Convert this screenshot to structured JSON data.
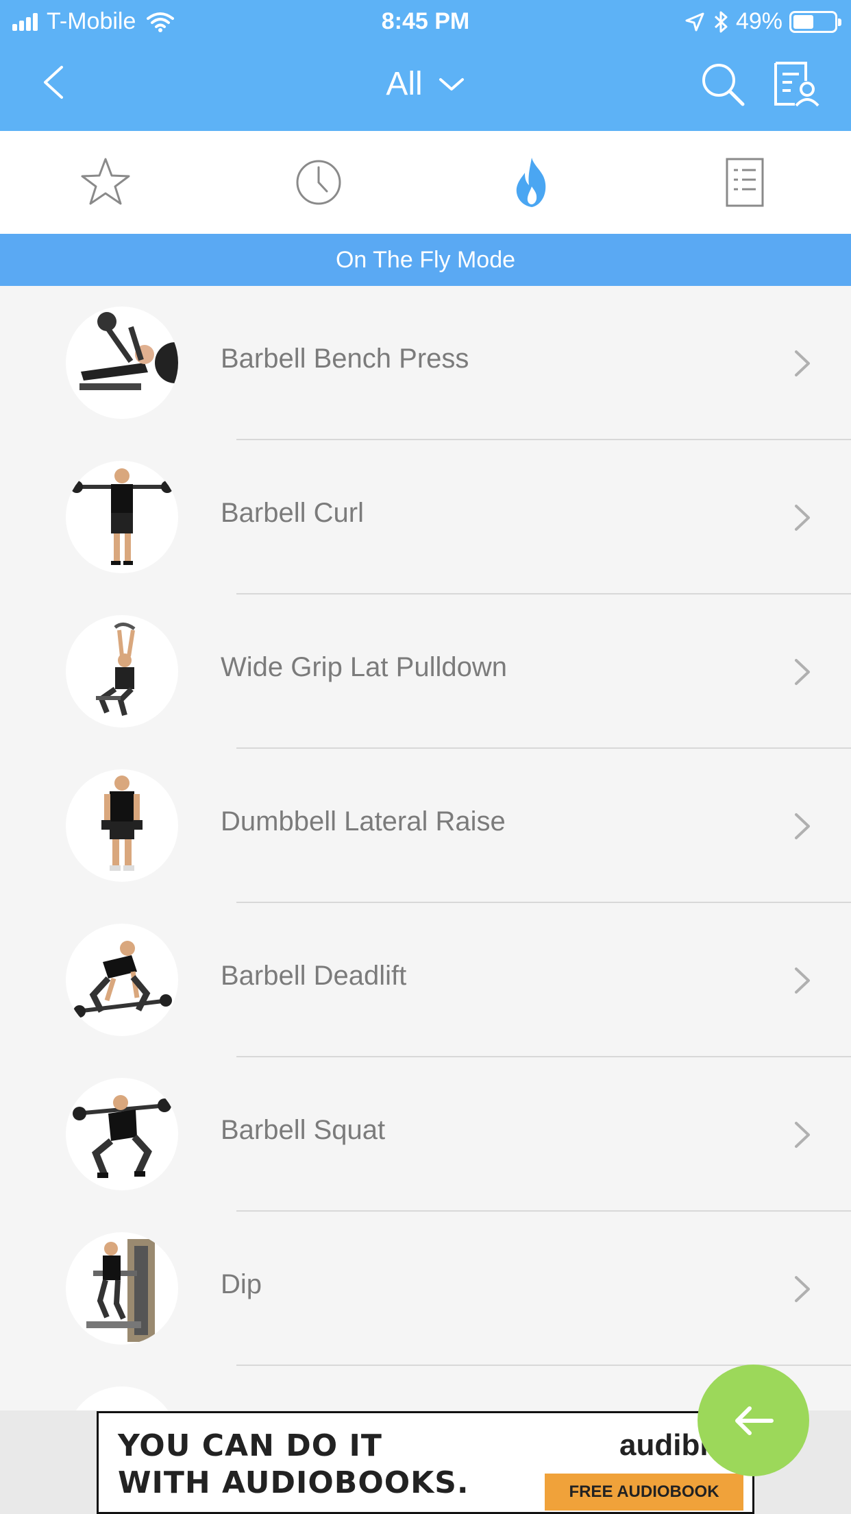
{
  "status_bar": {
    "carrier": "T-Mobile",
    "time": "8:45 PM",
    "battery_percent": "49%",
    "battery_level": 0.49
  },
  "nav": {
    "title": "All",
    "icons": [
      "back-icon",
      "chevron-down-icon",
      "search-icon",
      "profile-list-icon"
    ]
  },
  "tabs": [
    {
      "name": "favorites",
      "icon": "star-icon",
      "active": false
    },
    {
      "name": "history",
      "icon": "clock-icon",
      "active": false
    },
    {
      "name": "on-the-fly",
      "icon": "flame-icon",
      "active": true
    },
    {
      "name": "routines",
      "icon": "list-icon",
      "active": false
    }
  ],
  "mode_banner": "On The Fly Mode",
  "exercises": [
    {
      "label": "Barbell Bench Press"
    },
    {
      "label": "Barbell Curl"
    },
    {
      "label": "Wide Grip Lat Pulldown"
    },
    {
      "label": "Dumbbell Lateral Raise"
    },
    {
      "label": "Barbell Deadlift"
    },
    {
      "label": "Barbell Squat"
    },
    {
      "label": "Dip"
    }
  ],
  "ad": {
    "line1": "YOU CAN DO IT",
    "line2": "WITH AUDIOBOOKS.",
    "brand": "audible",
    "cta": "FREE AUDIOBOOK"
  },
  "colors": {
    "header": "#5db2f6",
    "banner": "#5aa9f3",
    "active_tab": "#4aa6f2",
    "fab": "#9cd85a",
    "ad_cta": "#f0a23a"
  }
}
